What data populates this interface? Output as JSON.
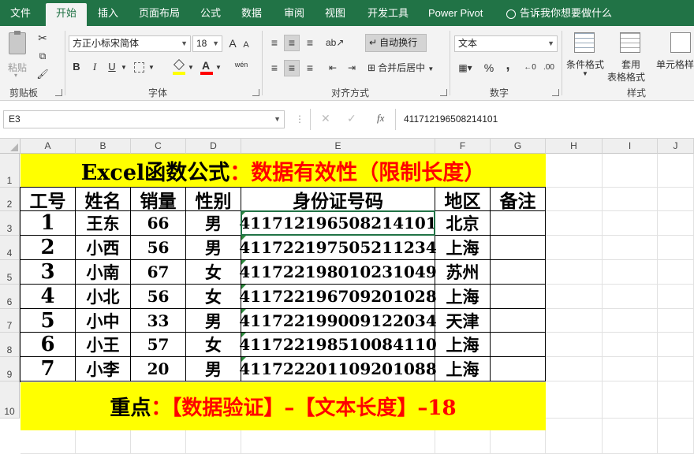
{
  "ribbon_tabs": [
    "文件",
    "开始",
    "插入",
    "页面布局",
    "公式",
    "数据",
    "审阅",
    "视图",
    "开发工具",
    "Power Pivot"
  ],
  "tell_me": "告诉我你想要做什么",
  "clipboard": {
    "paste": "粘贴",
    "group": "剪贴板"
  },
  "font": {
    "name": "方正小标宋简体",
    "size": "18",
    "group": "字体",
    "bold": "B",
    "italic": "I",
    "underline": "U",
    "grow": "A",
    "shrink": "A",
    "phonetic": "wén"
  },
  "alignment": {
    "wrap": "自动换行",
    "merge": "合并后居中",
    "group": "对齐方式"
  },
  "number": {
    "format": "文本",
    "group": "数字",
    "percent": "%",
    "comma": ","
  },
  "styles": {
    "conditional": "条件格式",
    "table_line1": "套用",
    "table_line2": "表格格式",
    "cell_styles": "单元格样",
    "group": "样式"
  },
  "formula_bar": {
    "name_box": "E3",
    "fx": "fx",
    "value": "411712196508214101"
  },
  "columns": [
    "A",
    "B",
    "C",
    "D",
    "E",
    "F",
    "G",
    "H",
    "I",
    "J"
  ],
  "rows": [
    "1",
    "2",
    "3",
    "4",
    "5",
    "6",
    "7",
    "8",
    "9",
    "10"
  ],
  "sheet": {
    "title_black": "Excel函数公式",
    "title_red": "：数据有效性（限制长度）",
    "headers": [
      "工号",
      "姓名",
      "销量",
      "性别",
      "身份证号码",
      "地区",
      "备注"
    ],
    "data": [
      [
        "1",
        "王东",
        "66",
        "男",
        "411712196508214101",
        "北京",
        ""
      ],
      [
        "2",
        "小西",
        "56",
        "男",
        "411722197505211234",
        "上海",
        ""
      ],
      [
        "3",
        "小南",
        "67",
        "女",
        "411722198010231049",
        "苏州",
        ""
      ],
      [
        "4",
        "小北",
        "56",
        "女",
        "411722196709201028",
        "上海",
        ""
      ],
      [
        "5",
        "小中",
        "33",
        "男",
        "411722199009122034",
        "天津",
        ""
      ],
      [
        "6",
        "小王",
        "57",
        "女",
        "411722198510084110",
        "上海",
        ""
      ],
      [
        "7",
        "小李",
        "20",
        "男",
        "411722201109201088",
        "上海",
        ""
      ]
    ],
    "footer_black": "重点",
    "footer_red": "：【数据验证】–【文本长度】–18"
  },
  "colors": {
    "ribbon_green": "#217346",
    "highlight_yellow": "#ffff00",
    "title_red": "#ff0000"
  }
}
